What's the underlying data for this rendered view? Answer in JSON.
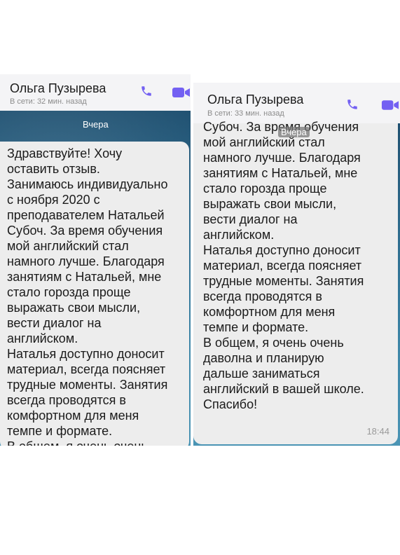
{
  "left": {
    "contact_name": "Ольга Пузырева",
    "status": "В сети: 32 мин. назад",
    "date_chip": "Вчера",
    "icons": [
      "phone-icon",
      "video-call-icon"
    ],
    "lines": [
      "Здравствуйте! Хочу",
      "оставить отзыв.",
      "Занимаюсь индивидуально",
      "с ноября 2020 с",
      "преподавателем Натальей",
      "Субоч. За время обучения",
      "мой английский стал",
      "намного лучше. Благодаря",
      "занятиям с Натальей, мне",
      "стало горозда проще",
      "выражать свои мысли,",
      "вести диалог на",
      "английском.",
      "Наталья доступно доносит",
      "материал, всегда поясняет",
      "трудные моменты. Занятия",
      "всегда проводятся в",
      "комфортном для меня",
      "темпе и формате.",
      "В общем, я очень очень"
    ]
  },
  "right": {
    "contact_name": "Ольга Пузырева",
    "status": "В сети: 33 мин. назад",
    "date_chip": "Вчера",
    "icons": [
      "phone-icon",
      "video-call-icon"
    ],
    "lines": [
      "Субоч. За время обучения",
      "мой английский стал",
      "намного лучше. Благодаря",
      "занятиям с Натальей, мне",
      "стало горозда проще",
      "выражать свои мысли,",
      "вести диалог на",
      "английском.",
      "Наталья доступно доносит",
      "материал, всегда поясняет",
      "трудные моменты. Занятия",
      "всегда проводятся в",
      "комфортном для меня",
      "темпе и формате.",
      "В общем, я очень очень",
      "даволна и планирую",
      "дальше заниматься",
      "английский в вашей школе.",
      "Спасибо!"
    ],
    "time": "18:44"
  },
  "colors": {
    "accent": "#7360f2",
    "header_bg": "#f4f4f6",
    "bubble_bg": "#ededed",
    "text": "#1b1b1b",
    "muted": "#8c8c8c"
  }
}
